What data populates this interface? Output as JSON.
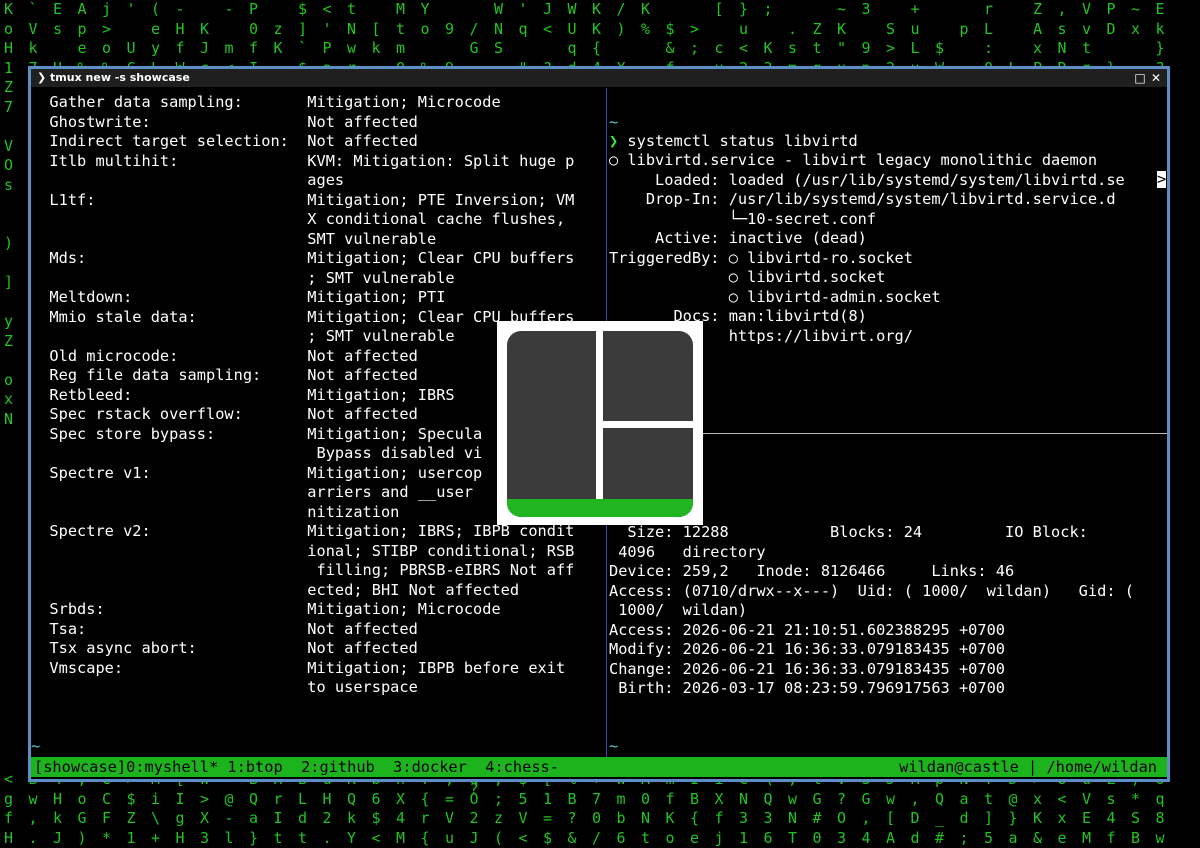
{
  "window": {
    "title": "❯ tmux new -s showcase",
    "maximize_icon": "□",
    "close_icon": "✕"
  },
  "left_pane": {
    "lines": [
      "  Gather data sampling:       Mitigation; Microcode",
      "  Ghostwrite:                 Not affected",
      "  Indirect target selection:  Not affected",
      "  Itlb multihit:              KVM: Mitigation: Split huge p",
      "                              ages",
      "  L1tf:                       Mitigation; PTE Inversion; VM",
      "                              X conditional cache flushes,",
      "                              SMT vulnerable",
      "  Mds:                        Mitigation; Clear CPU buffers",
      "                              ; SMT vulnerable",
      "  Meltdown:                   Mitigation; PTI",
      "  Mmio stale data:            Mitigation; Clear CPU buffers",
      "                              ; SMT vulnerable",
      "  Old microcode:              Not affected",
      "  Reg file data sampling:     Not affected",
      "  Retbleed:                   Mitigation; IBRS",
      "  Spec rstack overflow:       Not affected",
      "  Spec store bypass:          Mitigation; Specula",
      "                               Bypass disabled vi",
      "  Spectre v1:                 Mitigation; usercop",
      "                              arriers and __user",
      "                              nitization",
      "  Spectre v2:                 Mitigation; IBRS; IBPB condit",
      "                              ional; STIBP conditional; RSB",
      "                               filling; PBRSB-eIBRS Not aff",
      "                              ected; BHI Not affected",
      "  Srbds:                      Mitigation; Microcode",
      "  Tsa:                        Not affected",
      "  Tsx async abort:            Not affected",
      "  Vmscape:                    Mitigation; IBPB before exit",
      "                              to userspace"
    ],
    "prompt_tilde": "~",
    "prompt_arrow": "❯"
  },
  "right_top": {
    "tilde": "~",
    "prompt_arrow": "❯",
    "command": " systemctl status libvirtd",
    "lines": [
      "○ libvirtd.service - libvirt legacy monolithic daemon",
      "     Loaded: loaded (/usr/lib/systemd/system/libvirtd.se",
      "    Drop-In: /usr/lib/systemd/system/libvirtd.service.d",
      "             └─10-secret.conf",
      "     Active: inactive (dead)",
      "TriggeredBy: ○ libvirtd-ro.socket",
      "             ○ libvirtd.socket",
      "             ○ libvirtd-admin.socket",
      "       Docs: man:libvirtd(8)",
      "             https://libvirt.org/"
    ],
    "overflow_marker": ">"
  },
  "right_bottom": {
    "lines": [
      "  Size: 12288           Blocks: 24         IO Block:",
      " 4096   directory",
      "Device: 259,2   Inode: 8126466     Links: 46",
      "Access: (0710/drwx--x---)  Uid: ( 1000/  wildan)   Gid: (",
      " 1000/  wildan)",
      "Access: 2026-06-21 21:10:51.602388295 +0700",
      "Modify: 2026-06-21 16:36:33.079183435 +0700",
      "Change: 2026-06-21 16:36:33.079183435 +0700",
      " Birth: 2026-03-17 08:23:59.796917563 +0700"
    ],
    "prompt_tilde": "~",
    "prompt_arrow": "❯"
  },
  "status_bar": {
    "left": "[showcase]0:myshell* 1:btop  2:github  3:docker  4:chess-",
    "right": "wildan@castle | /home/wildan"
  },
  "logo": {
    "icon": "tmux-logo-icon"
  },
  "colors": {
    "border": "#5b8fc4",
    "status_bg": "#1db31d",
    "prompt_tilde": "#5bc8d6",
    "prompt_arrow": "#3ce83c",
    "matrix_green": "#22c322"
  }
}
